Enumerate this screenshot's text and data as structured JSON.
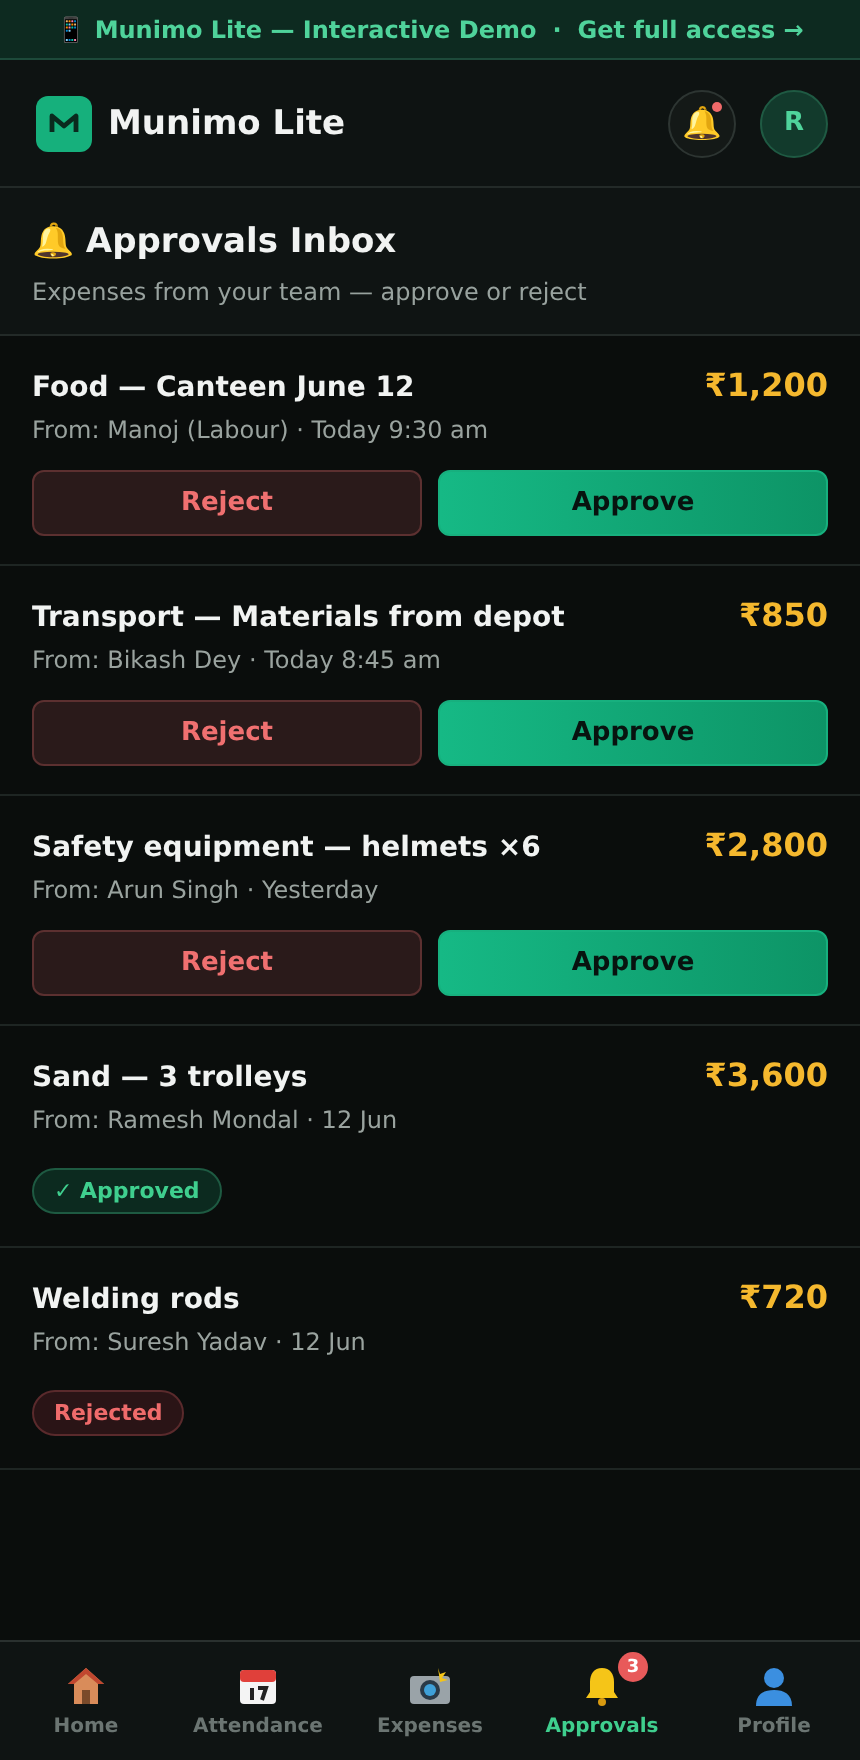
{
  "banner": {
    "text": "📱 Munimo Lite — Interactive Demo",
    "separator": "·",
    "link": "Get full access →"
  },
  "header": {
    "app_name": "Munimo Lite",
    "notification_icon": "🔔",
    "has_unread": true,
    "avatar": "R"
  },
  "page": {
    "icon": "🔔",
    "title": "Approvals Inbox",
    "subtitle": "Expenses from your team — approve or reject"
  },
  "requests": [
    {
      "kind": "pending",
      "title": "Food — Canteen June 12",
      "amount": "₹1,200",
      "meta": "From: Manoj (Labour) · Today 9:30 am",
      "reject": "Reject",
      "approve": "Approve"
    },
    {
      "kind": "pending",
      "title": "Transport — Materials from depot",
      "amount": "₹850",
      "meta": "From: Bikash Dey · Today 8:45 am",
      "reject": "Reject",
      "approve": "Approve"
    },
    {
      "kind": "pending",
      "title": "Safety equipment — helmets ×6",
      "amount": "₹2,800",
      "meta": "From: Arun Singh · Yesterday",
      "reject": "Reject",
      "approve": "Approve"
    },
    {
      "kind": "approved",
      "title": "Sand — 3 trolleys",
      "amount": "₹3,600",
      "meta": "From: Ramesh Mondal · 12 Jun",
      "status": "✓ Approved"
    },
    {
      "kind": "rejected",
      "title": "Welding rods",
      "amount": "₹720",
      "meta": "From: Suresh Yadav · 12 Jun",
      "status": "Rejected"
    }
  ],
  "nav": [
    {
      "kind": "home",
      "label": "Home",
      "selected": false
    },
    {
      "kind": "calendar",
      "label": "Attendance",
      "selected": false
    },
    {
      "kind": "camera",
      "label": "Expenses",
      "selected": false
    },
    {
      "kind": "bell",
      "label": "Approvals",
      "selected": true,
      "badge": "3"
    },
    {
      "kind": "person",
      "label": "Profile",
      "selected": false
    }
  ]
}
